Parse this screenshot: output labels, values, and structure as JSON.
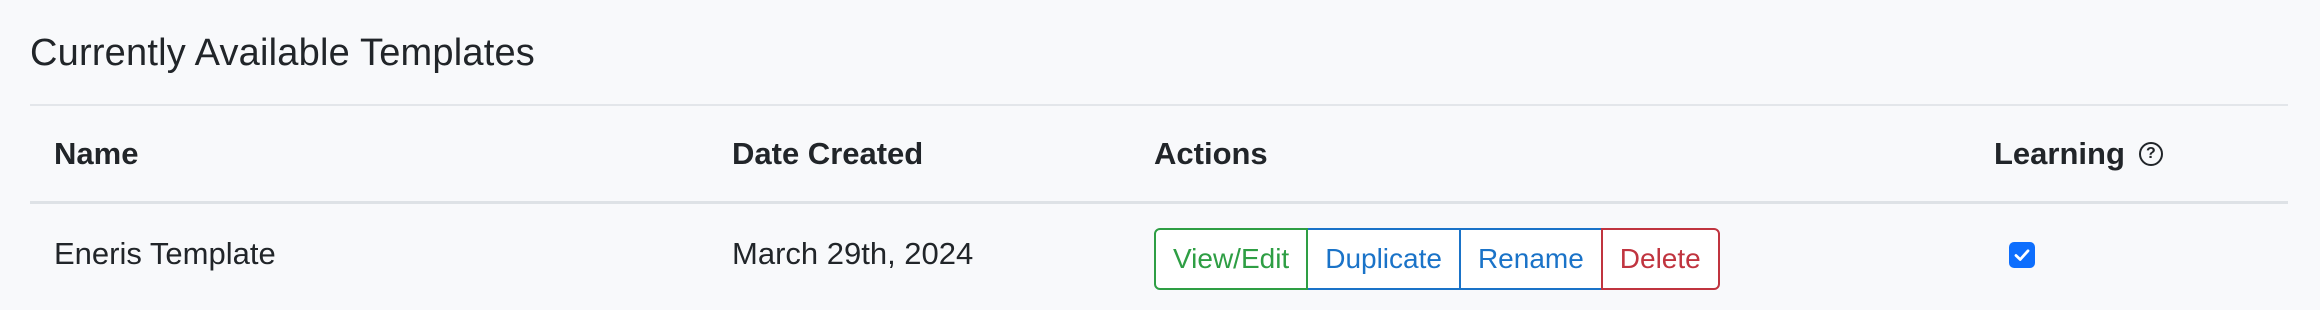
{
  "section": {
    "title": "Currently Available Templates"
  },
  "table": {
    "columns": {
      "name": "Name",
      "date_created": "Date Created",
      "actions": "Actions",
      "learning": "Learning"
    },
    "learning_help_icon": "question-circle-icon",
    "rows": [
      {
        "name": "Eneris Template",
        "date_created": "March 29th, 2024",
        "actions": {
          "view_edit": "View/Edit",
          "duplicate": "Duplicate",
          "rename": "Rename",
          "delete": "Delete"
        },
        "learning_enabled": true
      }
    ]
  },
  "colors": {
    "view_edit": "#2e9e44",
    "duplicate": "#1a73c8",
    "rename": "#1a73c8",
    "delete": "#c0343f",
    "checkbox": "#0d6efd"
  }
}
